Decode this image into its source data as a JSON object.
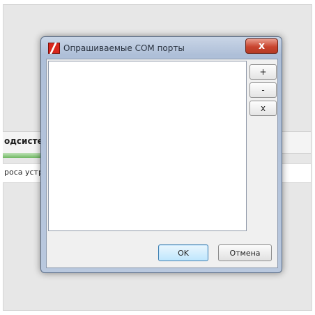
{
  "background": {
    "header_text": "одсисте",
    "row_text": "роса устр"
  },
  "dialog": {
    "title": "Опрашиваемые COM порты",
    "close_label": "x",
    "side_buttons": {
      "add": "+",
      "remove": "-",
      "clear": "x"
    },
    "ok_label": "OK",
    "cancel_label": "Отмена"
  },
  "colors": {
    "close_button": "#c9452f",
    "app_icon": "#d8261d",
    "progress_bar": "#5cb04d"
  },
  "icons": [
    "app-logo-icon",
    "close-icon"
  ]
}
